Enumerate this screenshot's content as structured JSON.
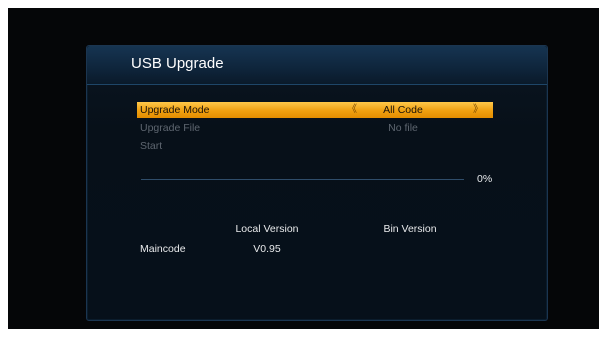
{
  "title": "USB Upgrade",
  "menu": {
    "upgrade_mode": {
      "label": "Upgrade Mode",
      "value": "All Code"
    },
    "upgrade_file": {
      "label": "Upgrade File",
      "value": "No file"
    },
    "start": {
      "label": "Start"
    }
  },
  "progress": {
    "percent_text": "0%",
    "fraction": 0
  },
  "versions": {
    "local_header": "Local Version",
    "bin_header": "Bin Version",
    "rows": [
      {
        "name": "Maincode",
        "local": "V0.95",
        "bin": ""
      }
    ]
  },
  "colors": {
    "accent": "#f0a010",
    "panel_border": "#1b3550",
    "title_bar": "#163451",
    "disabled_text": "#5e6670"
  },
  "icons": {
    "left_arrow": "chevron-left-icon",
    "right_arrow": "chevron-right-icon"
  }
}
